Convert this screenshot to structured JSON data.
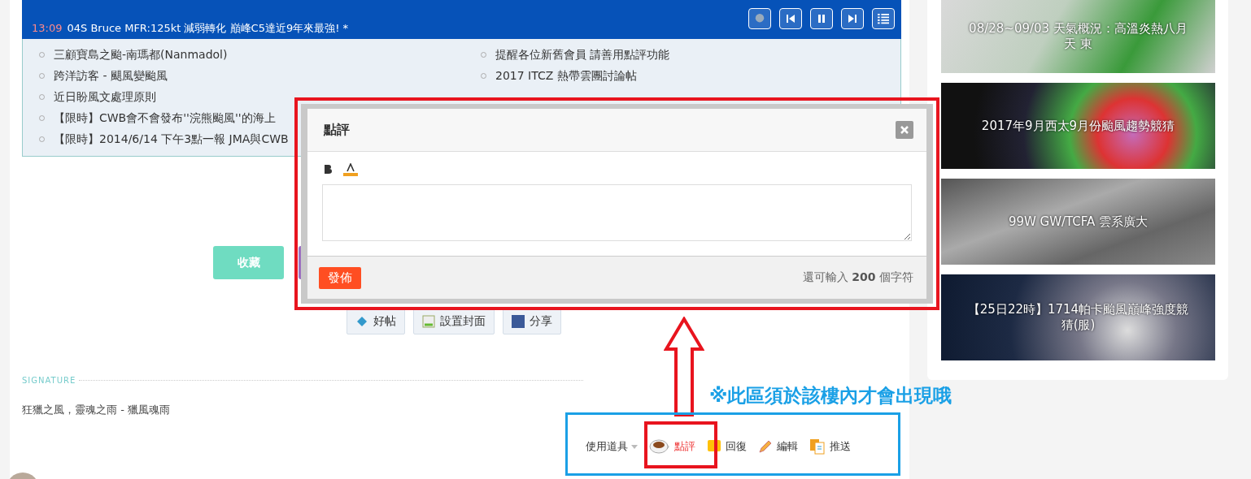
{
  "ticker": [
    {
      "time": "13:09",
      "text": "04S Bruce MFR:125kt 減弱轉化 巔峰C5達近9年來最強! *"
    }
  ],
  "links": [
    {
      "text": "三顧寶島之颱-南瑪都(Nanmadol)"
    },
    {
      "text": "跨洋訪客 - 颶風變颱風"
    },
    {
      "text": "近日盼風文處理原則"
    },
    {
      "text": "【限時】CWB會不會發布''浣熊颱風''的海上"
    },
    {
      "text": "【限時】2014/6/14 下午3點一報 JMA與CWB"
    },
    {
      "text": "提醒各位新舊會員 請善用點評功能"
    },
    {
      "text": "2017 ITCZ 熱帶雲團討論帖"
    }
  ],
  "post_buttons": [
    "收藏"
  ],
  "post_tools": [
    "好帖",
    "設置封面",
    "分享"
  ],
  "signature": {
    "label": "SIGNATURE",
    "text": "狂獵之風，靈魂之雨 - 獵風魂雨"
  },
  "actions": {
    "menu": "使用道具",
    "items": [
      {
        "kind": "rate",
        "label": "點評",
        "selected": true
      },
      {
        "kind": "reply",
        "label": "回復",
        "selected": false
      },
      {
        "kind": "edit",
        "label": "編輯",
        "selected": false
      },
      {
        "kind": "push",
        "label": "推送",
        "selected": false
      }
    ]
  },
  "dialog": {
    "title": "點評",
    "submit": "發佈",
    "counter_before": "還可輸入",
    "counter_number": "200",
    "counter_after": "個字符"
  },
  "sidebar": [
    {
      "title": "08/28~09/03 天氣概況：高溫炎熱八月天 東"
    },
    {
      "title": "2017年9月西太9月份颱風趨勢競猜"
    },
    {
      "title": "99W GW/TCFA 雲系廣大"
    },
    {
      "title": "【25日22時】1714帕卡颱風巔峰強度競猜(服)"
    }
  ],
  "annotation": {
    "note": "※此區須於該樓內才會出現哦"
  }
}
